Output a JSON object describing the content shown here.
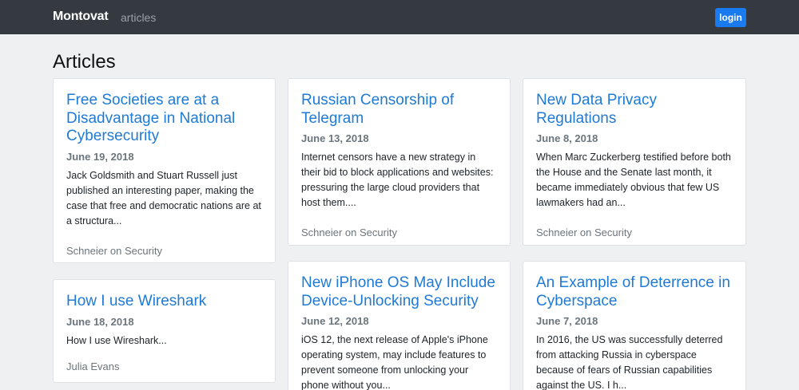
{
  "nav": {
    "brand": "Montovat",
    "link": "articles",
    "login": "login"
  },
  "page": {
    "title": "Articles"
  },
  "articles": [
    {
      "title": "Free Societies are at a Disadvantage in National Cybersecurity",
      "date": "June 19, 2018",
      "excerpt": "Jack Goldsmith and Stuart Russell just published an interesting paper, making the case that free and democratic nations are at a structura...",
      "source": "Schneier on Security"
    },
    {
      "title": "Russian Censorship of Telegram",
      "date": "June 13, 2018",
      "excerpt": "Internet censors have a new strategy in their bid to block applications and websites: pressuring the large cloud providers that host them....",
      "source": "Schneier on Security"
    },
    {
      "title": "New Data Privacy Regulations",
      "date": "June 8, 2018",
      "excerpt": "When Marc Zuckerberg testified before both the House and the Senate last month, it became immediately obvious that few US lawmakers had an...",
      "source": "Schneier on Security"
    },
    {
      "title": "How I use Wireshark",
      "date": "June 18, 2018",
      "excerpt": "How I use Wireshark...",
      "source": "Julia Evans"
    },
    {
      "title": "New iPhone OS May Include Device-Unlocking Security",
      "date": "June 12, 2018",
      "excerpt": "iOS 12, the next release of Apple's iPhone operating system, may include features to prevent someone from unlocking your phone without you...",
      "source": ""
    },
    {
      "title": "An Example of Deterrence in Cyberspace",
      "date": "June 7, 2018",
      "excerpt": "In 2016, the US was successfully deterred from attacking Russia in cyberspace because of fears of Russian capabilities against the US. I h...",
      "source": ""
    }
  ]
}
